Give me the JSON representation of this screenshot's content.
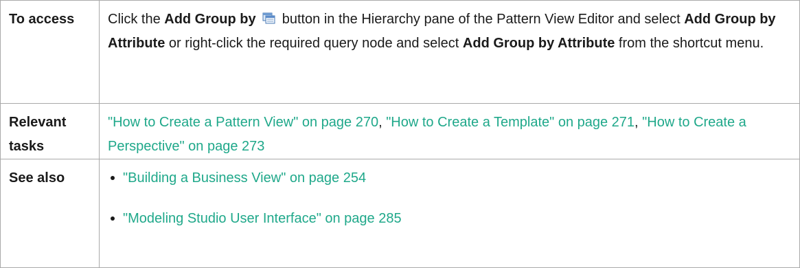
{
  "rows": {
    "access": {
      "label": "To access",
      "t1": "Click the ",
      "b1": "Add Group by",
      "icon": "add-group-by-icon",
      "t2": " button in the Hierarchy pane of the Pattern View Editor and select ",
      "b2": "Add Group by Attribute",
      "t3": " or right-click the required query node and select ",
      "b3": "Add Group by Attribute",
      "t4": " from the shortcut menu."
    },
    "tasks": {
      "label": "Relevant tasks",
      "links": [
        "\"How to Create a Pattern View\" on page 270",
        "\"How to Create a Template\" on page 271",
        "\"How to Create a Perspective\" on page 273"
      ],
      "separator": ", "
    },
    "see_also": {
      "label": "See also",
      "links": [
        "\"Building a Business View\" on page 254",
        "\"Modeling Studio User Interface\" on page 285"
      ]
    }
  },
  "colors": {
    "link": "#1fa88a",
    "border": "#a9a9a9",
    "text": "#1a1a1a"
  }
}
